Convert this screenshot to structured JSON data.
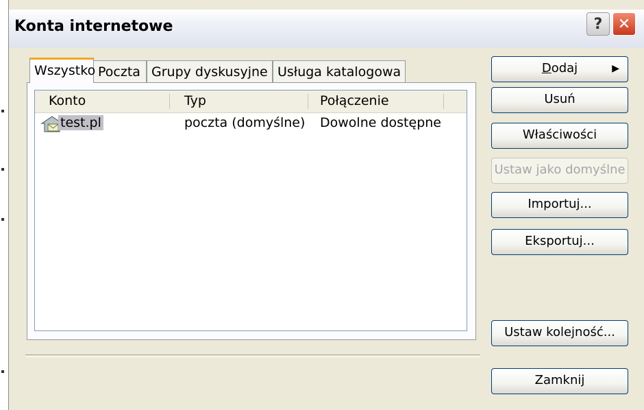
{
  "window": {
    "title": "Konta internetowe"
  },
  "titlebar": {
    "help_glyph": "?",
    "close_glyph": "✕"
  },
  "tabs": [
    "Wszystko",
    "Poczta",
    "Grupy dyskusyjne",
    "Usługa katalogowa"
  ],
  "columns": [
    "Konto",
    "Typ",
    "Połączenie"
  ],
  "accounts": [
    {
      "name": "test.pl",
      "type": "poczta (domyślne)",
      "connection": "Dowolne dostępne",
      "icon": "mail-account-icon"
    }
  ],
  "buttons": {
    "add_first": "D",
    "add_rest": "odaj",
    "add_arrow": "▶",
    "remove": "Usuń",
    "properties": "Właściwości",
    "set_default": "Ustaw jako domyślne",
    "import": "Importuj...",
    "export": "Eksportuj...",
    "set_order": "Ustaw kolejność...",
    "close": "Zamknij"
  }
}
